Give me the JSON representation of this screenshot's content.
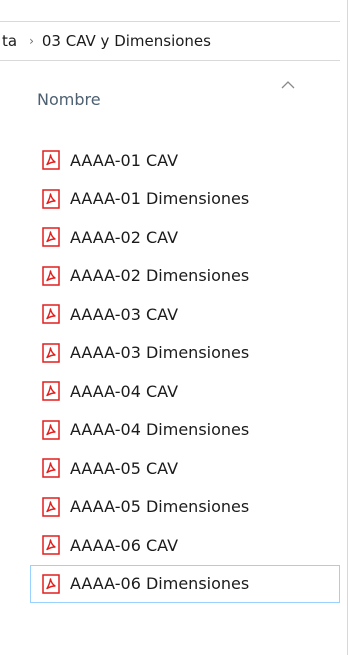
{
  "breadcrumb": {
    "previous": "ta",
    "separator": "›",
    "current": "03 CAV y Dimensiones"
  },
  "columns": {
    "name_header": "Nombre",
    "sort_direction": "ascending"
  },
  "files": [
    {
      "name": "AAAA-01 CAV",
      "icon": "pdf-file-icon",
      "selected": false
    },
    {
      "name": "AAAA-01 Dimensiones",
      "icon": "pdf-file-icon",
      "selected": false
    },
    {
      "name": "AAAA-02 CAV",
      "icon": "pdf-file-icon",
      "selected": false
    },
    {
      "name": "AAAA-02 Dimensiones",
      "icon": "pdf-file-icon",
      "selected": false
    },
    {
      "name": "AAAA-03 CAV",
      "icon": "pdf-file-icon",
      "selected": false
    },
    {
      "name": "AAAA-03 Dimensiones",
      "icon": "pdf-file-icon",
      "selected": false
    },
    {
      "name": "AAAA-04 CAV",
      "icon": "pdf-file-icon",
      "selected": false
    },
    {
      "name": "AAAA-04 Dimensiones",
      "icon": "pdf-file-icon",
      "selected": false
    },
    {
      "name": "AAAA-05 CAV",
      "icon": "pdf-file-icon",
      "selected": false
    },
    {
      "name": "AAAA-05 Dimensiones",
      "icon": "pdf-file-icon",
      "selected": false
    },
    {
      "name": "AAAA-06 CAV",
      "icon": "pdf-file-icon",
      "selected": false
    },
    {
      "name": "AAAA-06 Dimensiones",
      "icon": "pdf-file-icon",
      "selected": true
    }
  ],
  "colors": {
    "pdf_red": "#e01f1f",
    "selection_border": "#99d1ff",
    "header_text": "#4c6072"
  }
}
